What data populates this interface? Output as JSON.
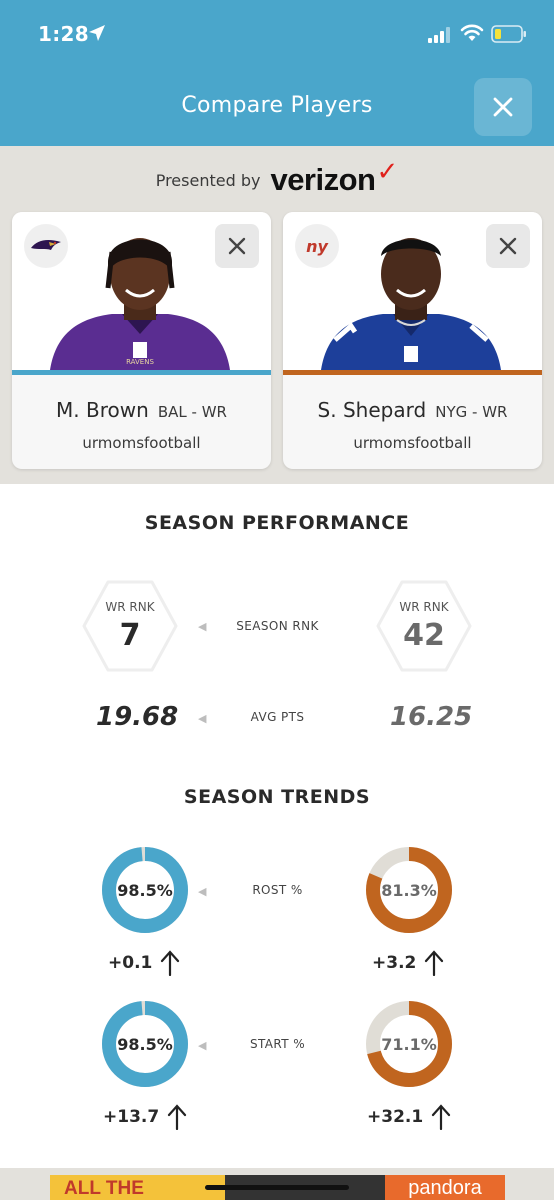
{
  "status_bar": {
    "time": "1:28"
  },
  "header": {
    "title": "Compare Players",
    "close_icon": "close-icon"
  },
  "sponsor": {
    "presented_by": "Presented by",
    "brand": "verizon",
    "brand_mark": "✓"
  },
  "colors": {
    "header": "#4aa6cb",
    "player1_accent": "#4aa6cb",
    "player2_accent": "#c0651f",
    "track": "#e0ddd6"
  },
  "players": [
    {
      "name": "M. Brown",
      "meta": "BAL - WR",
      "owner": "urmomsfootball",
      "team_icon": "ravens-logo-icon"
    },
    {
      "name": "S. Shepard",
      "meta": "NYG - WR",
      "owner": "urmomsfootball",
      "team_icon": "giants-logo-icon"
    }
  ],
  "season_performance": {
    "title": "SEASON PERFORMANCE",
    "rank_label": "SEASON RNK",
    "p1_rank_label": "WR RNK",
    "p1_rank": "7",
    "p2_rank_label": "WR RNK",
    "p2_rank": "42",
    "avg_label": "AVG PTS",
    "p1_avg": "19.68",
    "p2_avg": "16.25"
  },
  "season_trends": {
    "title": "SEASON TRENDS",
    "rost_label": "ROST %",
    "start_label": "START %",
    "p1_rost": "98.5%",
    "p1_rost_value": 98.5,
    "p1_rost_change": "+0.1",
    "p2_rost": "81.3%",
    "p2_rost_value": 81.3,
    "p2_rost_change": "+3.2",
    "p1_start": "98.5%",
    "p1_start_value": 98.5,
    "p1_start_change": "+13.7",
    "p2_start": "71.1%",
    "p2_start_value": 71.1,
    "p2_start_change": "+32.1"
  },
  "ad": {
    "left_text": "ALL THE",
    "right_text": "pandora"
  }
}
